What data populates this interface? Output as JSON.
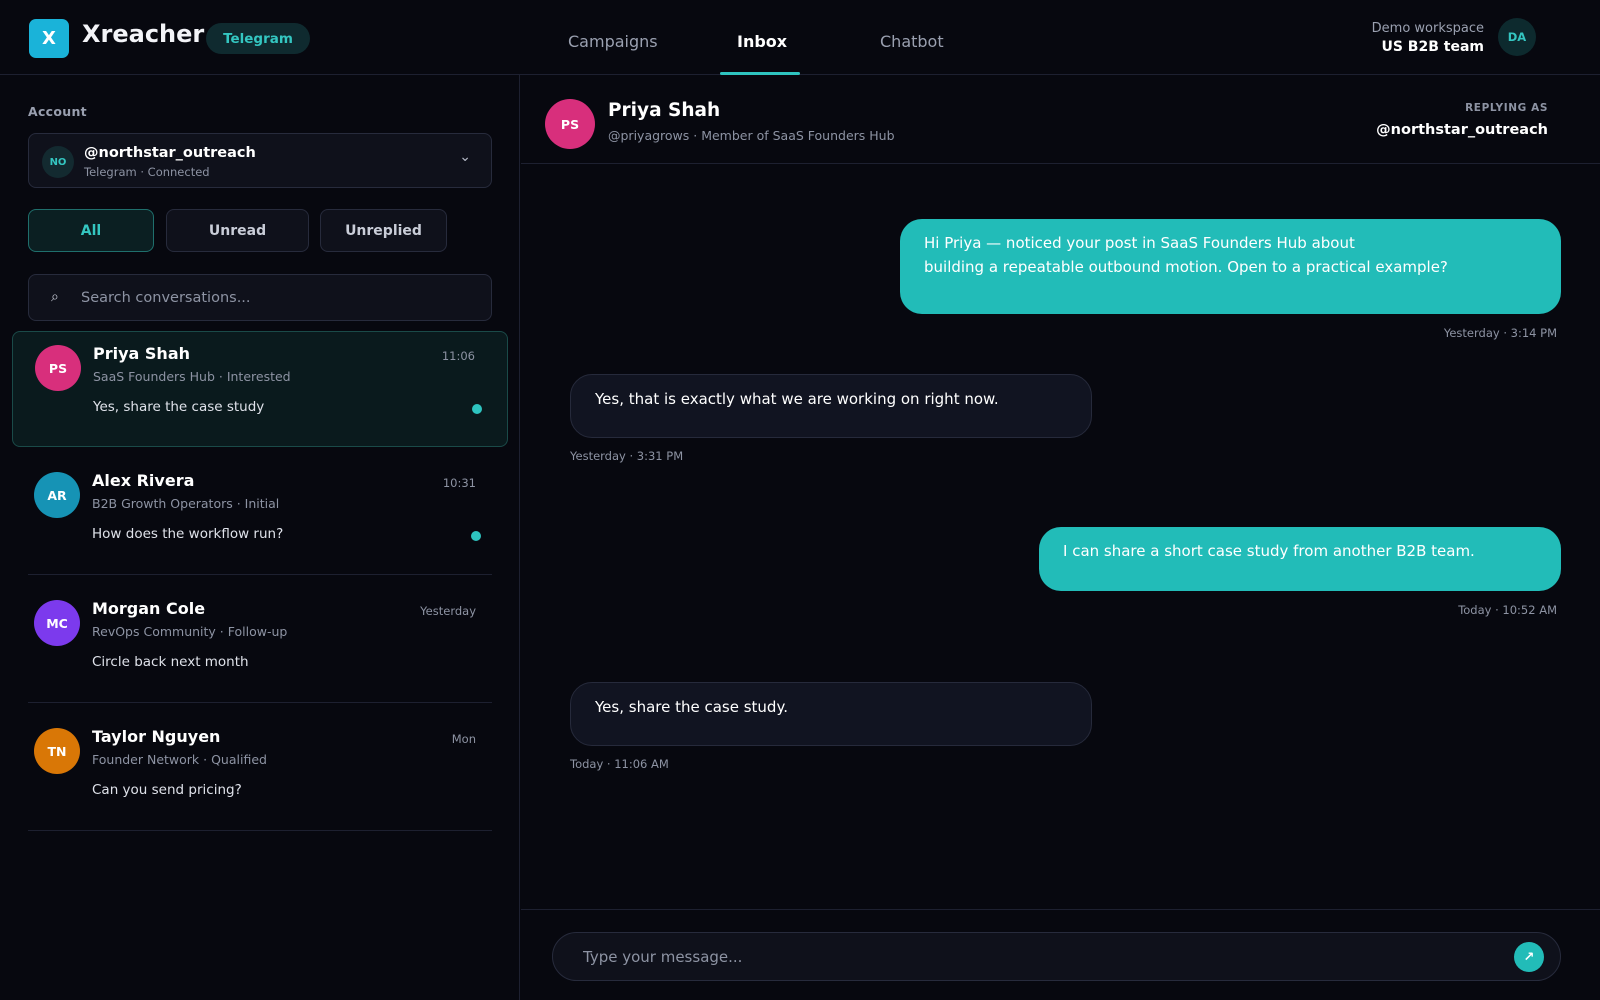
{
  "app": {
    "logo_letter": "X",
    "brand": "Xreacher",
    "channel_badge": "Telegram"
  },
  "nav": {
    "tabs": [
      {
        "label": "Campaigns",
        "active": false
      },
      {
        "label": "Inbox",
        "active": true
      },
      {
        "label": "Chatbot",
        "active": false
      }
    ]
  },
  "workspace": {
    "label": "Demo workspace",
    "name": "US B2B team",
    "avatar_initials": "DA"
  },
  "sidebar": {
    "account_label": "Account",
    "account": {
      "initials": "NO",
      "handle": "@northstar_outreach",
      "status": "Telegram · Connected"
    },
    "filters": [
      {
        "label": "All",
        "active": true
      },
      {
        "label": "Unread",
        "active": false
      },
      {
        "label": "Unreplied",
        "active": false
      }
    ],
    "search": {
      "placeholder": "Search conversations..."
    },
    "conversations": [
      {
        "initials": "PS",
        "name": "Priya Shah",
        "subtitle": "SaaS Founders Hub · Interested",
        "preview": "Yes, share the case study",
        "time": "11:06",
        "unread": true,
        "selected": true,
        "avatar_color": "#d82f7c"
      },
      {
        "initials": "AR",
        "name": "Alex Rivera",
        "subtitle": "B2B Growth Operators · Initial",
        "preview": "How does the workflow run?",
        "time": "10:31",
        "unread": true,
        "selected": false,
        "avatar_color": "#1693b5"
      },
      {
        "initials": "MC",
        "name": "Morgan Cole",
        "subtitle": "RevOps Community · Follow-up",
        "preview": "Circle back next month",
        "time": "Yesterday",
        "unread": false,
        "selected": false,
        "avatar_color": "#7c3aed"
      },
      {
        "initials": "TN",
        "name": "Taylor Nguyen",
        "subtitle": "Founder Network · Qualified",
        "preview": "Can you send pricing?",
        "time": "Mon",
        "unread": false,
        "selected": false,
        "avatar_color": "#d97706"
      }
    ]
  },
  "chat": {
    "contact": {
      "initials": "PS",
      "name": "Priya Shah",
      "subtitle": "@priyagrows · Member of SaaS Founders Hub"
    },
    "replying_label": "REPLYING AS",
    "replying_handle": "@northstar_outreach",
    "messages": [
      {
        "direction": "out",
        "text": "Hi Priya — noticed your post in SaaS Founders Hub about\nbuilding a repeatable outbound motion. Open to a practical example?",
        "time": "Yesterday · 3:14 PM"
      },
      {
        "direction": "in",
        "text": "Yes, that is exactly what we are working on right now.",
        "time": "Yesterday · 3:31 PM"
      },
      {
        "direction": "out",
        "text": "I can share a short case study from another B2B team.",
        "time": "Today · 10:52 AM"
      },
      {
        "direction": "in",
        "text": "Yes, share the case study.",
        "time": "Today · 11:06 AM"
      }
    ],
    "composer": {
      "placeholder": "Type your message...",
      "send_icon": "↗"
    }
  },
  "colors": {
    "accent": "#22bcb8",
    "background": "#07080f",
    "brand_logo": "#1ab3d9"
  },
  "icons": {
    "search": "search-icon",
    "dropdown": "chevron-down-icon",
    "send": "send-icon"
  }
}
